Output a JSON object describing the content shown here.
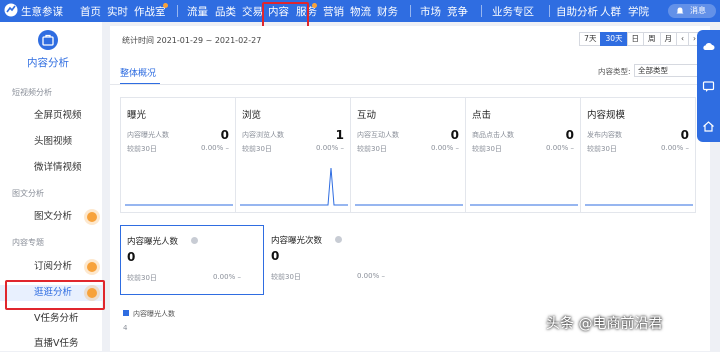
{
  "app": {
    "brand": "生意参谋"
  },
  "topnav": [
    "首页",
    "实时",
    "作战室",
    "流量",
    "品类",
    "交易",
    "内容",
    "服务",
    "营销",
    "物流",
    "财务",
    "市场",
    "竞争",
    "业务专区",
    "自助分析",
    "人群",
    "学院"
  ],
  "messages": "消息",
  "sidebar": {
    "title": "内容分析",
    "sections": [
      {
        "label": "短视频分析",
        "items": [
          "全屏页视频",
          "头图视频",
          "微详情视频"
        ]
      },
      {
        "label": "图文分析",
        "items": [
          "图文分析"
        ]
      },
      {
        "label": "内容专题",
        "items": [
          "订阅分析",
          "逛逛分析",
          "V任务分析",
          "直播V任务"
        ]
      }
    ],
    "active_item": "逛逛分析"
  },
  "main": {
    "period": "统计时间 2021-01-29 ~ 2021-02-27",
    "range_buttons": [
      "7天",
      "30天",
      "日",
      "周",
      "月"
    ],
    "range_active": "30天",
    "tab": "整体概况",
    "content_type_label": "内容类型:",
    "content_type_value": "全部类型",
    "cards": [
      {
        "title": "曝光",
        "metric": "内容曝光人数",
        "value": "0",
        "compare": "较前30日",
        "pct": "0.00%"
      },
      {
        "title": "浏览",
        "metric": "内容浏览人数",
        "value": "1",
        "compare": "较前30日",
        "pct": "0.00%"
      },
      {
        "title": "互动",
        "metric": "内容互动人数",
        "value": "0",
        "compare": "较前30日",
        "pct": "0.00%"
      },
      {
        "title": "点击",
        "metric": "商品点击人数",
        "value": "0",
        "compare": "较前30日",
        "pct": "0.00%"
      },
      {
        "title": "内容规模",
        "metric": "发布内容数",
        "value": "0",
        "compare": "较前30日",
        "pct": "0.00%"
      }
    ],
    "subcards": [
      {
        "title": "内容曝光人数",
        "value": "0",
        "compare": "较前30日",
        "pct": "0.00%"
      },
      {
        "title": "内容曝光次数",
        "value": "0",
        "compare": "较前30日",
        "pct": "0.00%"
      }
    ],
    "legend": "内容曝光人数",
    "y_tick": "4"
  },
  "watermark": "头条 @电商前沿君",
  "colors": {
    "primary": "#2f6de1",
    "highlight": "#e0262d",
    "accent": "#f7a23b"
  }
}
